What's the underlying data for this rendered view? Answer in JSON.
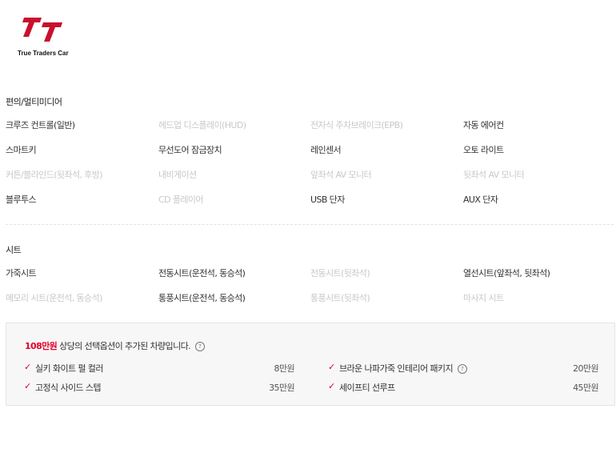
{
  "brand": {
    "logo_text": "True Traders Car",
    "accent": "#c8102e"
  },
  "sections": [
    {
      "title": "편의/멀티미디어",
      "rows": [
        [
          {
            "label": "크루즈 컨트롤(일반)",
            "active": true
          },
          {
            "label": "헤드업 디스플레이(HUD)",
            "active": false
          },
          {
            "label": "전자식 주차브레이크(EPB)",
            "active": false
          },
          {
            "label": "자동 에어컨",
            "active": true
          }
        ],
        [
          {
            "label": "스마트키",
            "active": true
          },
          {
            "label": "무선도어 잠금장치",
            "active": true
          },
          {
            "label": "레인센서",
            "active": true
          },
          {
            "label": "오토 라이트",
            "active": true
          }
        ],
        [
          {
            "label": "커튼/블라인드(뒷좌석, 후방)",
            "active": false
          },
          {
            "label": "내비게이션",
            "active": false
          },
          {
            "label": "앞좌석 AV 모니터",
            "active": false
          },
          {
            "label": "뒷좌석 AV 모니터",
            "active": false
          }
        ],
        [
          {
            "label": "블루투스",
            "active": true
          },
          {
            "label": "CD 플레이어",
            "active": false
          },
          {
            "label": "USB 단자",
            "active": true
          },
          {
            "label": "AUX 단자",
            "active": true
          }
        ]
      ]
    },
    {
      "title": "시트",
      "rows": [
        [
          {
            "label": "가죽시트",
            "active": true
          },
          {
            "label": "전동시트(운전석, 동승석)",
            "active": true
          },
          {
            "label": "전동시트(뒷좌석)",
            "active": false
          },
          {
            "label": "열선시트(앞좌석, 뒷좌석)",
            "active": true
          }
        ],
        [
          {
            "label": "메모리 시트(운전석, 동승석)",
            "active": false
          },
          {
            "label": "통풍시트(운전석, 동승석)",
            "active": true
          },
          {
            "label": "통풍시트(뒷좌석)",
            "active": false
          },
          {
            "label": "마사지 시트",
            "active": false
          }
        ]
      ]
    }
  ],
  "options": {
    "price": "108만원",
    "summary_text": " 상당의 선택옵션이 추가된 차량입니다.",
    "help_glyph": "?",
    "check_glyph": "✓",
    "items": [
      {
        "name": "실키 화이트 펄 컬러",
        "price": "8만원"
      },
      {
        "name": "브라운 나파가죽 인테리어 패키지",
        "price": "20만원"
      },
      {
        "name": "고정식 사이드 스텝",
        "price": "35만원"
      },
      {
        "name": "세이프티 선루프",
        "price": "45만원"
      }
    ]
  }
}
